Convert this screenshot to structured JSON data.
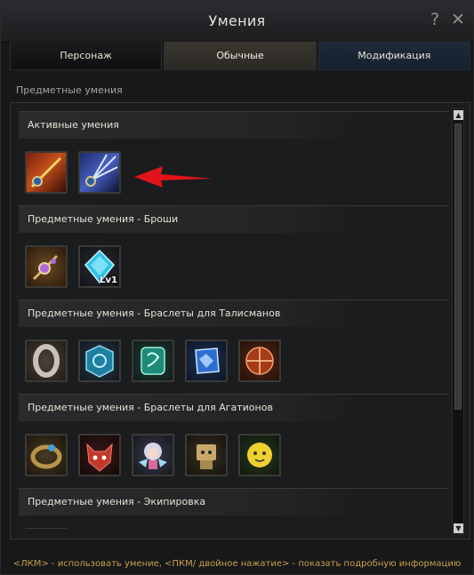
{
  "window": {
    "title": "Умения",
    "help_label": "?",
    "close_label": "✕"
  },
  "tabs": [
    {
      "label": "Персонаж"
    },
    {
      "label": "Обычные"
    },
    {
      "label": "Модификация"
    }
  ],
  "section_caption": "Предметные умения",
  "groups": [
    {
      "title": "Активные умения",
      "icons": [
        "active-skill-sword-beam-icon",
        "active-skill-sword-burst-icon"
      ]
    },
    {
      "title": "Предметные умения - Броши",
      "icons": [
        "brooch-purple-icon",
        "brooch-blue-gem-icon"
      ],
      "level_badge": "Lv1"
    },
    {
      "title": "Предметные умения - Браслеты для Талисманов",
      "icons": [
        "bracelet-silver-icon",
        "talisman-blue-rune-icon",
        "talisman-green-rune-icon",
        "talisman-blue-crystal-icon",
        "talisman-red-rune-icon"
      ]
    },
    {
      "title": "Предметные умения - Браслеты для Агатионов",
      "icons": [
        "agathion-bracelet-icon",
        "agathion-red-demon-icon",
        "agathion-fairy-girl-icon",
        "agathion-box-robot-icon",
        "agathion-yellow-star-icon"
      ]
    },
    {
      "title": "Предметные умения - Экипировка",
      "icons": [
        "equipment-item-icon"
      ]
    }
  ],
  "footer_hint": "<ЛКМ> - использовать умение, <ПКМ/ двойное нажатие> - показать подробную информацию",
  "colors": {
    "accent_gold": "#c8a04a",
    "arrow_red": "#e0141a"
  }
}
